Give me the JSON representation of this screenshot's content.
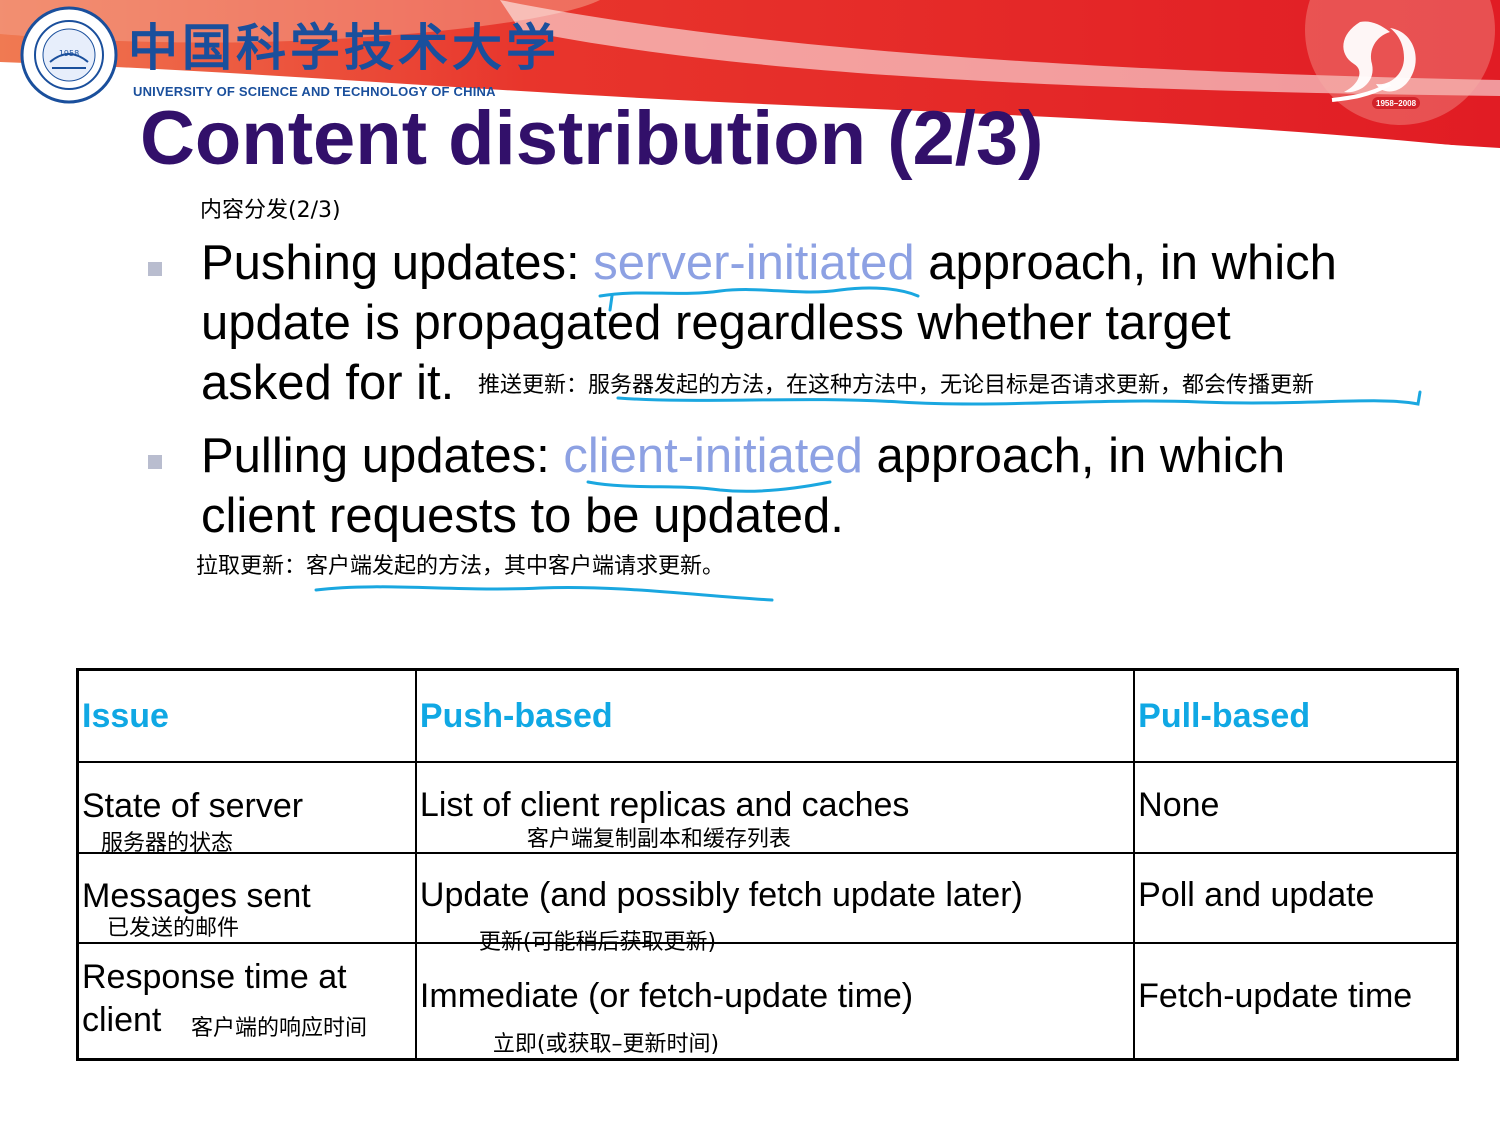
{
  "header": {
    "university_cn": "中国科学技术大学",
    "university_en": "UNIVERSITY OF SCIENCE AND TECHNOLOGY OF CHINA",
    "seal_year": "1958",
    "anniversary_years": "1958–2008"
  },
  "slide": {
    "title": "Content distribution (2/3)",
    "subtitle_cn": "内容分发(2/3)"
  },
  "bullets": [
    {
      "lead": "Pushing updates: ",
      "highlight": "server-initiated",
      "rest_line1": " approach, in which",
      "line2": "update is propagated regardless whether target",
      "line3": "asked for it.",
      "note_cn": "推送更新：服务器发起的方法，在这种方法中，无论目标是否请求更新，都会传播更新"
    },
    {
      "lead": "Pulling updates: ",
      "highlight": "client-initiated",
      "rest_line1": " approach, in which",
      "line2": "client requests to be updated.",
      "note_cn": "拉取更新：客户端发起的方法，其中客户端请求更新。"
    }
  ],
  "table": {
    "headers": [
      "Issue",
      "Push-based",
      "Pull-based"
    ],
    "rows": [
      {
        "issue": "State of server",
        "issue_cn": "服务器的状态",
        "push": "List of client replicas and caches",
        "push_cn": "客户端复制副本和缓存列表",
        "pull": "None"
      },
      {
        "issue": "Messages sent",
        "issue_cn": "已发送的邮件",
        "push": "Update (and possibly fetch update later)",
        "push_cn": "更新(可能稍后获取更新)",
        "pull": "Poll and update"
      },
      {
        "issue_line1": "Response time at",
        "issue_line2": "client",
        "issue_cn": "客户端的响应时间",
        "push": "Immediate (or fetch-update time)",
        "push_cn": "立即(或获取–更新时间)",
        "pull": "Fetch-update time"
      }
    ]
  },
  "colors": {
    "title": "#32106a",
    "highlight": "#8da1e3",
    "table_header": "#10a8e4",
    "annotation": "#1aa7e0",
    "banner_red": "#e8252a"
  }
}
